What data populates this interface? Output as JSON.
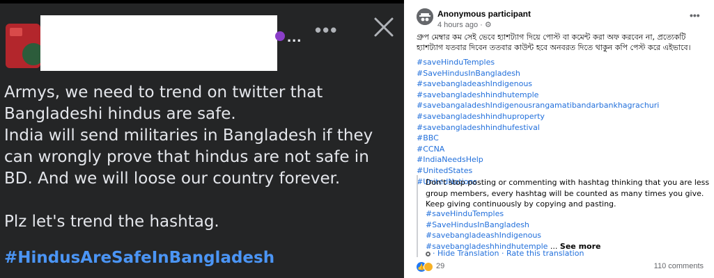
{
  "left_post": {
    "body_paragraphs": [
      "Armys, we need to trend on twitter that Bangladeshi hindus are safe.\nIndia will send militaries in Bangladesh if they can wrongly prove that hindus are not safe in BD.  And we will loose our country forever.",
      "Plz let's trend the hashtag."
    ],
    "hashtag": "#HindusAreSafeInBangladesh",
    "ellipsis": "...",
    "more_label": "•••",
    "accent_color": "#4b95f5"
  },
  "right_post": {
    "author": "Anonymous participant",
    "meta": "4 hours ago · ⚙",
    "bangla_text": "গ্রুপ মেম্বার কম সেই ভেবে হ্যাশট্যাগ দিয়ে পোস্ট বা কমেন্ট করা অফ করবেন না, প্রত্যেকটি হ্যাশট্যাগ যতবার দিবেন ততবার কাউন্ট হবে অনবরত দিতে থাকুন কপি পেস্ট করে এইভাবে।",
    "hashtags": [
      "#saveHinduTemples",
      "#SaveHindusInBangladesh",
      "#savebangladeashIndigenous",
      "#savebangladeshhindhutemple",
      "#savebangaladeshIndigenousrangamatibandarbankhagrachuri",
      "#savebangladeshhindhuproperty",
      "#savebangladeshhindhufestival",
      "#BBC",
      "#CCNA",
      "#IndiaNeedsHelp",
      "#UnitedStates",
      "#UnitedNations"
    ],
    "translation": {
      "text": "Don't stop posting or commenting with hashtag thinking that you are less group members, every hashtag will be counted as many times you give. Keep giving continuously by copying and pasting.",
      "hashtags": [
        "#saveHinduTemples",
        "#SaveHindusInBangladesh",
        "#savebangladeashIndigenous"
      ],
      "last_tag": "savebangladeshhindhutemple",
      "ellipsis": " ...",
      "see_more": "See more",
      "links": "· Hide Translation · Rate this translation"
    },
    "reaction_count": "29",
    "comment_count": "110 comments",
    "more_label": "•••",
    "link_color": "#216fdb"
  }
}
